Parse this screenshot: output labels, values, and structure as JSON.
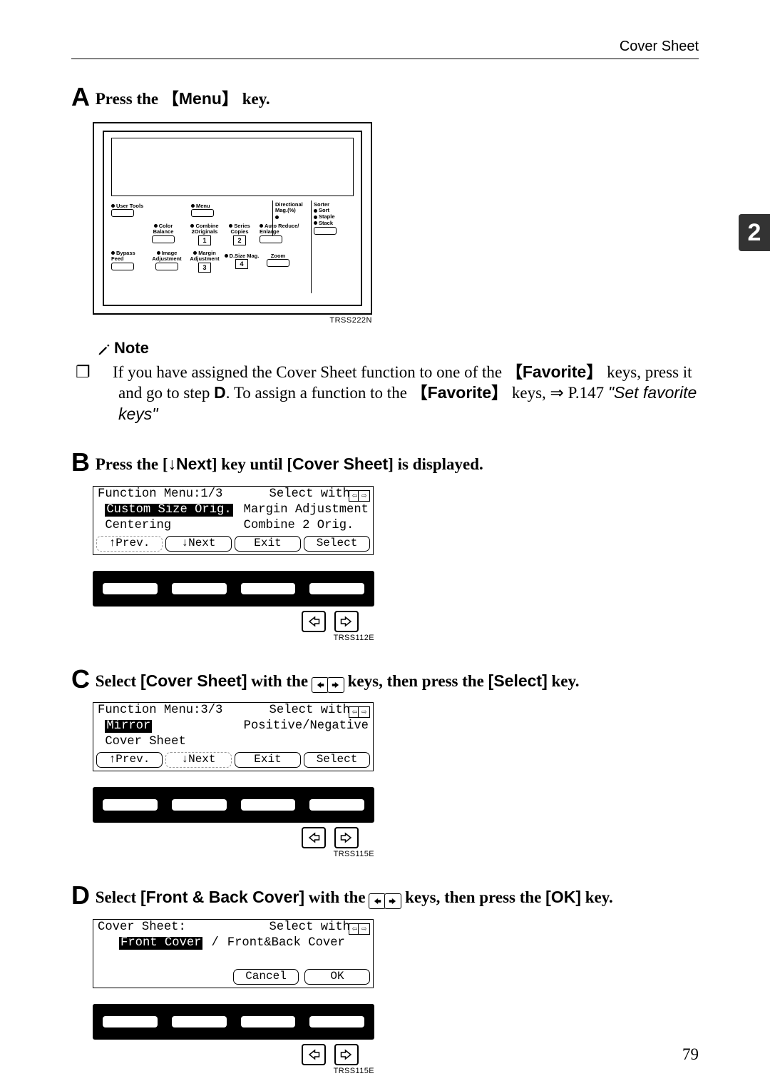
{
  "header": {
    "title": "Cover Sheet"
  },
  "chapter_tab": "2",
  "page_number": "79",
  "steps": {
    "A": {
      "letter": "A",
      "pre": "Press the ",
      "key": "Menu",
      "post": " key.",
      "panel": {
        "code": "TRSS222N",
        "labels": {
          "user_tools": "User Tools",
          "menu": "Menu",
          "color_balance": "Color\nBalance",
          "combine_2orig": "Combine\n2Originals",
          "series_copies": "Series\nCopies",
          "directional_mag": "Directional\nMag.(%)",
          "sorter": "Sorter",
          "sort": "Sort",
          "staple": "Staple",
          "stack": "Stack",
          "auto_reduce_enlarge": "Auto Reduce/\nEnlarge",
          "bypass_feed": "Bypass\nFeed",
          "image_adj": "Image\nAdjustment",
          "margin_adj": "Margin\nAdjustment",
          "dsize_mag": "D.Size Mag.",
          "zoom": "Zoom",
          "n1": "1",
          "n2": "2",
          "n3": "3",
          "n4": "4"
        }
      }
    },
    "B": {
      "letter": "B",
      "text_pre": "Press the [",
      "down": "↓",
      "next": "Next",
      "mid": "] key until [",
      "cover_sheet": "Cover Sheet",
      "text_post": "] is displayed.",
      "lcd": {
        "title_left": "Function Menu:1/3",
        "title_right_pre": "Select with",
        "row1_left": "Custom Size Orig.",
        "row1_right": "Margin Adjustment",
        "row2_left": "Centering",
        "row2_right": "Combine 2 Orig.",
        "soft": {
          "prev": "↑Prev.",
          "next": "↓Next",
          "exit": "Exit",
          "select": "Select"
        },
        "code": "TRSS112E"
      }
    },
    "C": {
      "letter": "C",
      "pre": "Select ",
      "cover_sheet_label": "[Cover Sheet]",
      "mid1": " with the ",
      "mid2": " keys, then press the ",
      "select_label": "[Select]",
      "post": " key.",
      "lcd": {
        "title_left": "Function Menu:3/3",
        "title_right_pre": "Select with",
        "row1_left": "Mirror",
        "row1_right": "Positive/Negative",
        "row2_left": "Cover Sheet",
        "soft": {
          "prev": "↑Prev.",
          "next": "↓Next",
          "exit": "Exit",
          "select": "Select"
        },
        "code": "TRSS115E"
      }
    },
    "D": {
      "letter": "D",
      "pre": "Select ",
      "fb_label": "[Front & Back Cover]",
      "mid1": " with the ",
      "mid2": " keys, then press the ",
      "ok_label": "[OK]",
      "post": " key.",
      "lcd": {
        "title_left": "Cover Sheet:",
        "title_right_pre": "Select with",
        "row1_left": "Front Cover",
        "row1_sep": "/",
        "row1_right": "Front&Back Cover",
        "soft": {
          "cancel": "Cancel",
          "ok": "OK"
        },
        "code": "TRSS115E"
      }
    }
  },
  "note": {
    "heading": "Note",
    "bullet": "❐",
    "text1": "If you have assigned the Cover Sheet function to one of the ",
    "fav": "Favorite",
    "text2": " keys, press it and go to step ",
    "step_ref": "D",
    "text3": ". To assign a function to the ",
    "text4": " keys, ⇒ P.147 ",
    "text5": "\"Set favorite keys\""
  }
}
